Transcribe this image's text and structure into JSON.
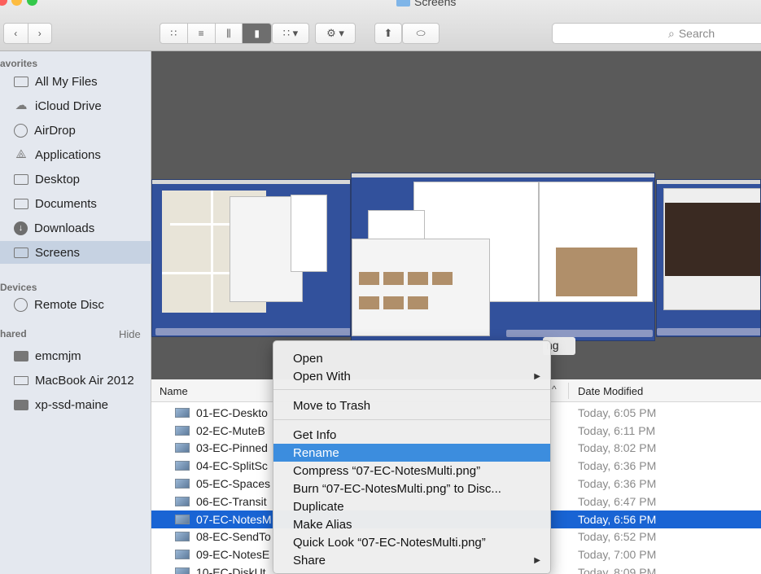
{
  "window": {
    "title": "Screens"
  },
  "toolbar": {
    "back_icon": "chevron-left",
    "forward_icon": "chevron-right",
    "view_modes": [
      "icon-view",
      "list-view",
      "column-view",
      "cover-flow-view"
    ],
    "active_view": "cover-flow-view",
    "arrange_icon": "grid-arrange",
    "action_icon": "gear",
    "share_icon": "share",
    "tag_icon": "tag",
    "search_placeholder": "Search"
  },
  "sidebar": {
    "favorites_label": "avorites",
    "favorites": [
      {
        "label": "All My Files",
        "icon": "all-files"
      },
      {
        "label": "iCloud Drive",
        "icon": "cloud"
      },
      {
        "label": "AirDrop",
        "icon": "airdrop"
      },
      {
        "label": "Applications",
        "icon": "applications"
      },
      {
        "label": "Desktop",
        "icon": "desktop"
      },
      {
        "label": "Documents",
        "icon": "documents"
      },
      {
        "label": "Downloads",
        "icon": "downloads"
      },
      {
        "label": "Screens",
        "icon": "folder",
        "selected": true
      }
    ],
    "devices_label": "Devices",
    "devices": [
      {
        "label": "Remote Disc",
        "icon": "disc"
      }
    ],
    "shared_label": "hared",
    "hide_label": "Hide",
    "shared": [
      {
        "label": "emcmjm",
        "icon": "monitor"
      },
      {
        "label": "MacBook Air 2012",
        "icon": "laptop"
      },
      {
        "label": "xp-ssd-maine",
        "icon": "monitor"
      }
    ]
  },
  "preview": {
    "caption_fragment": "ng"
  },
  "list": {
    "col_name": "Name",
    "col_date": "Date Modified",
    "rows": [
      {
        "name": "01-EC-Deskto",
        "date": "Today, 6:05 PM"
      },
      {
        "name": "02-EC-MuteB",
        "date": "Today, 6:11 PM"
      },
      {
        "name": "03-EC-Pinned",
        "date": "Today, 8:02 PM"
      },
      {
        "name": "04-EC-SplitSc",
        "date": "Today, 6:36 PM"
      },
      {
        "name": "05-EC-Spaces",
        "date": "Today, 6:36 PM"
      },
      {
        "name": "06-EC-Transit",
        "date": "Today, 6:47 PM"
      },
      {
        "name": "07-EC-NotesM",
        "date": "Today, 6:56 PM",
        "selected": true
      },
      {
        "name": "08-EC-SendTo",
        "date": "Today, 6:52 PM"
      },
      {
        "name": "09-EC-NotesE",
        "date": "Today, 7:00 PM"
      },
      {
        "name": "10-EC-DiskUt",
        "date": "Today, 8:09 PM"
      }
    ]
  },
  "context_menu": {
    "open": "Open",
    "open_with": "Open With",
    "move_to_trash": "Move to Trash",
    "get_info": "Get Info",
    "rename": "Rename",
    "compress": "Compress “07-EC-NotesMulti.png”",
    "burn": "Burn “07-EC-NotesMulti.png” to Disc...",
    "duplicate": "Duplicate",
    "make_alias": "Make Alias",
    "quick_look": "Quick Look “07-EC-NotesMulti.png”",
    "share": "Share",
    "highlighted": "rename"
  },
  "colors": {
    "selection_blue": "#1964d4",
    "menu_highlight": "#3c8dde",
    "sidebar_bg": "#e4e8ef",
    "preview_bg": "#5a5a5a"
  }
}
